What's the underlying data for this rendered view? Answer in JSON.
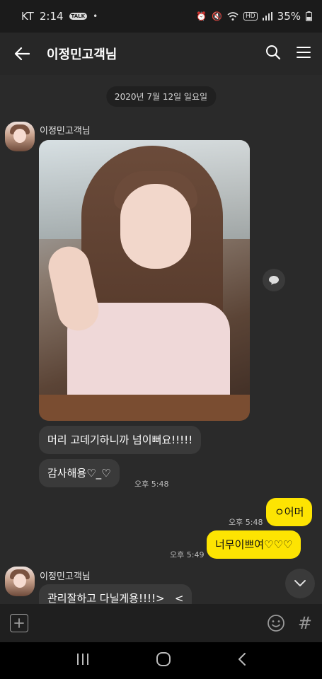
{
  "status_bar": {
    "carrier": "KT",
    "time": "2:14",
    "battery": "35%",
    "icons": [
      "talk-notification-icon",
      "dot-icon",
      "alarm-icon",
      "mute-icon",
      "wifi-icon",
      "hd-icon",
      "signal-icon",
      "battery-icon"
    ],
    "talk_badge": "TALK"
  },
  "app_bar": {
    "title": "이정민고객님",
    "icons": [
      "back-arrow-icon",
      "search-icon",
      "menu-icon"
    ]
  },
  "chat": {
    "date_divider": "2020년 7월 12일 일요일",
    "messages": [
      {
        "side": "in",
        "sender": "이정민고객님",
        "type": "photo"
      },
      {
        "side": "in",
        "text": "머리 고데기하니까 넘이뻐요!!!!!"
      },
      {
        "side": "in",
        "text": "감사해용♡_♡",
        "time": "오후 5:48"
      },
      {
        "side": "out",
        "text": "ㅇ어머",
        "time": "오후 5:48"
      },
      {
        "side": "out",
        "text": "너무이쁘여♡♡♡",
        "time": "오후 5:49"
      },
      {
        "side": "in",
        "sender": "이정민고객님",
        "text": "관리잘하고 다닐게용!!!!>   <"
      }
    ]
  },
  "input_bar": {
    "icons": [
      "add-icon",
      "emoji-icon",
      "hashtag-icon"
    ],
    "hash_glyph": "#"
  },
  "nav_bar": {
    "icons": [
      "recent-apps-icon",
      "home-icon",
      "back-icon"
    ]
  },
  "colors": {
    "chat_bg": "#2a2a2a",
    "incoming_bubble": "#3a3a3a",
    "outgoing_bubble": "#fde402",
    "app_bar": "#272727"
  }
}
